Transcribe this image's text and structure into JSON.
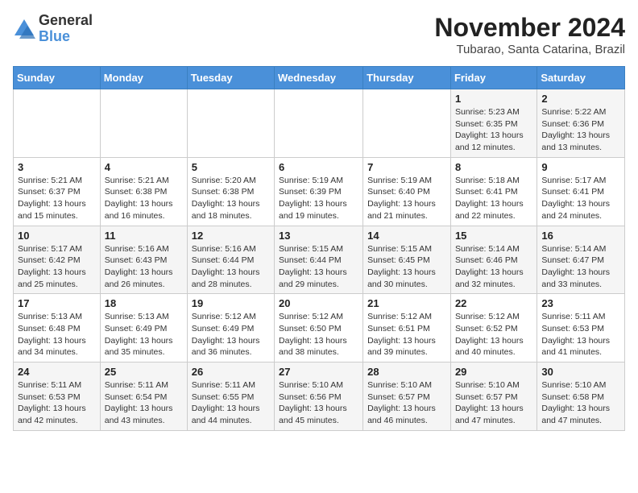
{
  "logo": {
    "general": "General",
    "blue": "Blue"
  },
  "title": "November 2024",
  "location": "Tubarao, Santa Catarina, Brazil",
  "days_of_week": [
    "Sunday",
    "Monday",
    "Tuesday",
    "Wednesday",
    "Thursday",
    "Friday",
    "Saturday"
  ],
  "weeks": [
    [
      {
        "day": "",
        "info": ""
      },
      {
        "day": "",
        "info": ""
      },
      {
        "day": "",
        "info": ""
      },
      {
        "day": "",
        "info": ""
      },
      {
        "day": "",
        "info": ""
      },
      {
        "day": "1",
        "info": "Sunrise: 5:23 AM\nSunset: 6:35 PM\nDaylight: 13 hours and 12 minutes."
      },
      {
        "day": "2",
        "info": "Sunrise: 5:22 AM\nSunset: 6:36 PM\nDaylight: 13 hours and 13 minutes."
      }
    ],
    [
      {
        "day": "3",
        "info": "Sunrise: 5:21 AM\nSunset: 6:37 PM\nDaylight: 13 hours and 15 minutes."
      },
      {
        "day": "4",
        "info": "Sunrise: 5:21 AM\nSunset: 6:38 PM\nDaylight: 13 hours and 16 minutes."
      },
      {
        "day": "5",
        "info": "Sunrise: 5:20 AM\nSunset: 6:38 PM\nDaylight: 13 hours and 18 minutes."
      },
      {
        "day": "6",
        "info": "Sunrise: 5:19 AM\nSunset: 6:39 PM\nDaylight: 13 hours and 19 minutes."
      },
      {
        "day": "7",
        "info": "Sunrise: 5:19 AM\nSunset: 6:40 PM\nDaylight: 13 hours and 21 minutes."
      },
      {
        "day": "8",
        "info": "Sunrise: 5:18 AM\nSunset: 6:41 PM\nDaylight: 13 hours and 22 minutes."
      },
      {
        "day": "9",
        "info": "Sunrise: 5:17 AM\nSunset: 6:41 PM\nDaylight: 13 hours and 24 minutes."
      }
    ],
    [
      {
        "day": "10",
        "info": "Sunrise: 5:17 AM\nSunset: 6:42 PM\nDaylight: 13 hours and 25 minutes."
      },
      {
        "day": "11",
        "info": "Sunrise: 5:16 AM\nSunset: 6:43 PM\nDaylight: 13 hours and 26 minutes."
      },
      {
        "day": "12",
        "info": "Sunrise: 5:16 AM\nSunset: 6:44 PM\nDaylight: 13 hours and 28 minutes."
      },
      {
        "day": "13",
        "info": "Sunrise: 5:15 AM\nSunset: 6:44 PM\nDaylight: 13 hours and 29 minutes."
      },
      {
        "day": "14",
        "info": "Sunrise: 5:15 AM\nSunset: 6:45 PM\nDaylight: 13 hours and 30 minutes."
      },
      {
        "day": "15",
        "info": "Sunrise: 5:14 AM\nSunset: 6:46 PM\nDaylight: 13 hours and 32 minutes."
      },
      {
        "day": "16",
        "info": "Sunrise: 5:14 AM\nSunset: 6:47 PM\nDaylight: 13 hours and 33 minutes."
      }
    ],
    [
      {
        "day": "17",
        "info": "Sunrise: 5:13 AM\nSunset: 6:48 PM\nDaylight: 13 hours and 34 minutes."
      },
      {
        "day": "18",
        "info": "Sunrise: 5:13 AM\nSunset: 6:49 PM\nDaylight: 13 hours and 35 minutes."
      },
      {
        "day": "19",
        "info": "Sunrise: 5:12 AM\nSunset: 6:49 PM\nDaylight: 13 hours and 36 minutes."
      },
      {
        "day": "20",
        "info": "Sunrise: 5:12 AM\nSunset: 6:50 PM\nDaylight: 13 hours and 38 minutes."
      },
      {
        "day": "21",
        "info": "Sunrise: 5:12 AM\nSunset: 6:51 PM\nDaylight: 13 hours and 39 minutes."
      },
      {
        "day": "22",
        "info": "Sunrise: 5:12 AM\nSunset: 6:52 PM\nDaylight: 13 hours and 40 minutes."
      },
      {
        "day": "23",
        "info": "Sunrise: 5:11 AM\nSunset: 6:53 PM\nDaylight: 13 hours and 41 minutes."
      }
    ],
    [
      {
        "day": "24",
        "info": "Sunrise: 5:11 AM\nSunset: 6:53 PM\nDaylight: 13 hours and 42 minutes."
      },
      {
        "day": "25",
        "info": "Sunrise: 5:11 AM\nSunset: 6:54 PM\nDaylight: 13 hours and 43 minutes."
      },
      {
        "day": "26",
        "info": "Sunrise: 5:11 AM\nSunset: 6:55 PM\nDaylight: 13 hours and 44 minutes."
      },
      {
        "day": "27",
        "info": "Sunrise: 5:10 AM\nSunset: 6:56 PM\nDaylight: 13 hours and 45 minutes."
      },
      {
        "day": "28",
        "info": "Sunrise: 5:10 AM\nSunset: 6:57 PM\nDaylight: 13 hours and 46 minutes."
      },
      {
        "day": "29",
        "info": "Sunrise: 5:10 AM\nSunset: 6:57 PM\nDaylight: 13 hours and 47 minutes."
      },
      {
        "day": "30",
        "info": "Sunrise: 5:10 AM\nSunset: 6:58 PM\nDaylight: 13 hours and 47 minutes."
      }
    ]
  ]
}
